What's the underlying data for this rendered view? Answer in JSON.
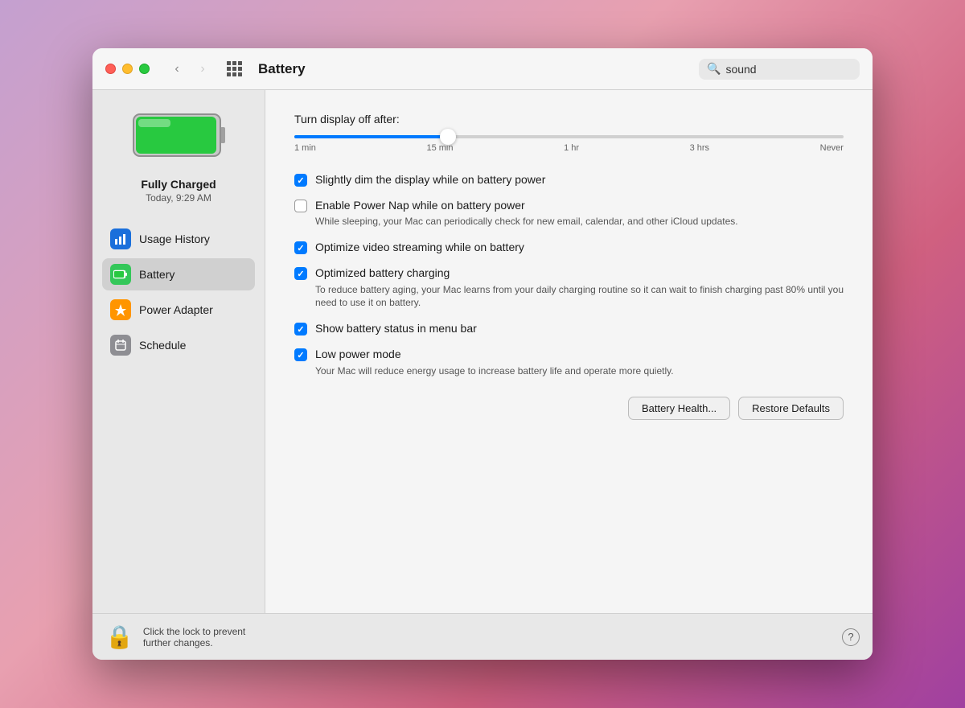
{
  "titlebar": {
    "title": "Battery",
    "back_button": "‹",
    "forward_button": "›",
    "search_placeholder": "sound",
    "search_value": "sound"
  },
  "sidebar": {
    "battery_status": "Fully Charged",
    "battery_time": "Today, 9:29 AM",
    "items": [
      {
        "id": "usage-history",
        "label": "Usage History",
        "icon": "📊",
        "icon_class": "icon-blue"
      },
      {
        "id": "battery",
        "label": "Battery",
        "icon": "🔋",
        "icon_class": "icon-green",
        "active": true
      },
      {
        "id": "power-adapter",
        "label": "Power Adapter",
        "icon": "⚡",
        "icon_class": "icon-orange"
      },
      {
        "id": "schedule",
        "label": "Schedule",
        "icon": "📅",
        "icon_class": "icon-gray"
      }
    ]
  },
  "main": {
    "slider_label": "Turn display off after:",
    "slider_value": 28,
    "slider_marks": [
      "1 min",
      "15 min",
      "1 hr",
      "3 hrs",
      "Never"
    ],
    "options": [
      {
        "id": "dim-display",
        "checked": true,
        "label": "Slightly dim the display while on battery power",
        "sublabel": ""
      },
      {
        "id": "power-nap",
        "checked": false,
        "label": "Enable Power Nap while on battery power",
        "sublabel": "While sleeping, your Mac can periodically check for new email, calendar, and other iCloud updates."
      },
      {
        "id": "video-streaming",
        "checked": true,
        "label": "Optimize video streaming while on battery",
        "sublabel": ""
      },
      {
        "id": "battery-charging",
        "checked": true,
        "label": "Optimized battery charging",
        "sublabel": "To reduce battery aging, your Mac learns from your daily charging routine so it can wait to finish charging past 80% until you need to use it on battery."
      },
      {
        "id": "battery-status",
        "checked": true,
        "label": "Show battery status in menu bar",
        "sublabel": ""
      },
      {
        "id": "low-power",
        "checked": true,
        "label": "Low power mode",
        "sublabel": "Your Mac will reduce energy usage to increase battery life and operate more quietly."
      }
    ],
    "battery_health_btn": "Battery Health...",
    "restore_defaults_btn": "Restore Defaults"
  },
  "lockbar": {
    "text_line1": "Click the lock to prevent",
    "text_line2": "further changes.",
    "help_label": "?"
  }
}
